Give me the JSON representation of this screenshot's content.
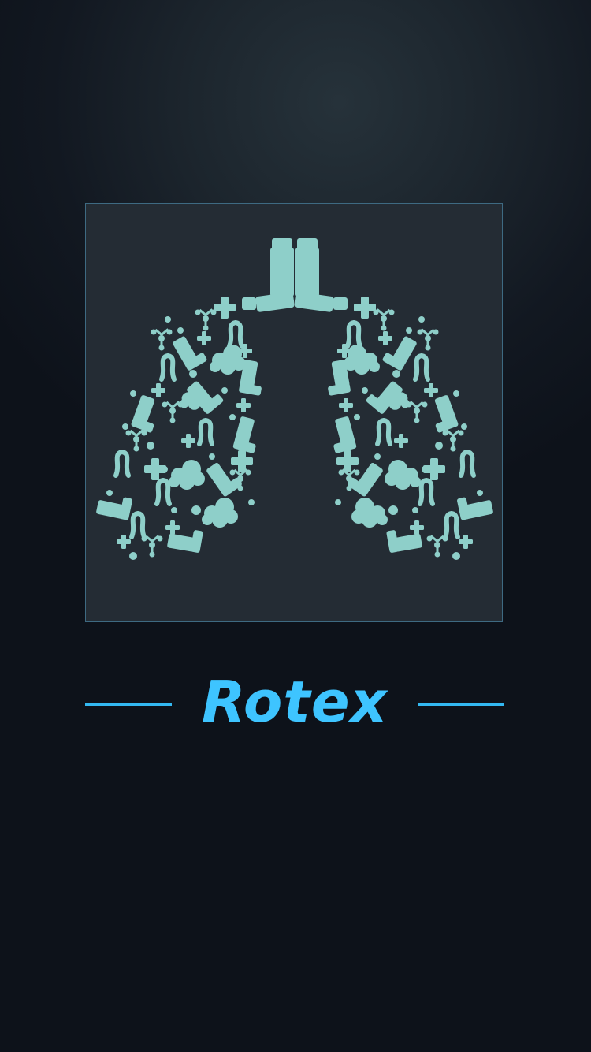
{
  "splash": {
    "logo_icon": "lungs-icon",
    "brand_name": "Rotex"
  },
  "colors": {
    "background": "#121821",
    "card": "#242c34",
    "card_border": "#3e6a82",
    "lungs": "#8ecfc9",
    "brand": "#3ec4ff",
    "divider": "#33b8f2"
  }
}
